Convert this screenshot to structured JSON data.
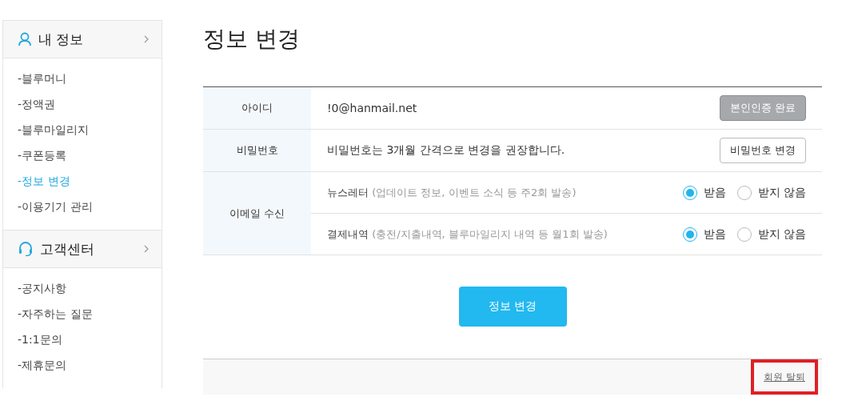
{
  "sidebar": {
    "sections": [
      {
        "title": "내 정보",
        "items": [
          {
            "label": "-블루머니",
            "selected": false
          },
          {
            "label": "-정액권",
            "selected": false
          },
          {
            "label": "-블루마일리지",
            "selected": false
          },
          {
            "label": "-쿠폰등록",
            "selected": false
          },
          {
            "label": "-정보 변경",
            "selected": true
          },
          {
            "label": "-이용기기 관리",
            "selected": false
          }
        ]
      },
      {
        "title": "고객센터",
        "items": [
          {
            "label": "-공지사항",
            "selected": false
          },
          {
            "label": "-자주하는 질문",
            "selected": false
          },
          {
            "label": "-1:1문의",
            "selected": false
          },
          {
            "label": "-제휴문의",
            "selected": false
          }
        ]
      }
    ]
  },
  "page_title": "정보 변경",
  "form": {
    "rows": [
      {
        "kind": "text",
        "label": "아이디",
        "value": "!0@hanmail.net",
        "button": {
          "label": "본인인증 완료",
          "disabled": true
        }
      },
      {
        "kind": "text",
        "label": "비밀번호",
        "value": "비밀번호는 3개월 간격으로 변경을 권장합니다.",
        "button": {
          "label": "비밀번호 변경",
          "disabled": false
        }
      },
      {
        "kind": "radio",
        "label": "이메일 수신",
        "options": [
          {
            "name": "뉴스레터",
            "note": "(업데이트 정보, 이벤트 소식 등 주2회 발송)",
            "choices": [
              {
                "label": "받음",
                "selected": true
              },
              {
                "label": "받지 않음",
                "selected": false
              }
            ]
          },
          {
            "name": "결제내역",
            "note": "(충전/지출내역, 블루마일리지 내역 등 월1회 발송)",
            "choices": [
              {
                "label": "받음",
                "selected": true
              },
              {
                "label": "받지 않음",
                "selected": false
              }
            ]
          }
        ]
      }
    ]
  },
  "submit": "정보 변경",
  "footer": {
    "withdraw": "회원 탈퇴",
    "highlighted": true
  }
}
